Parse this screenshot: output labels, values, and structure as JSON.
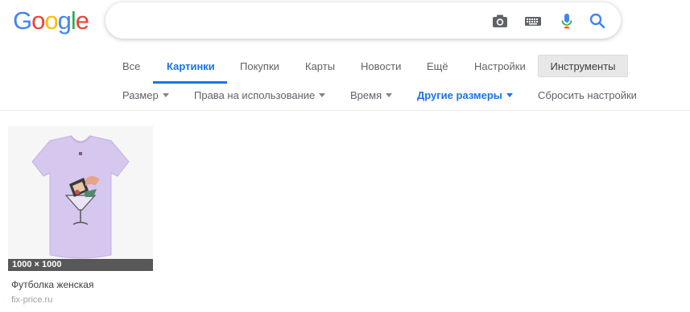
{
  "logo": {
    "letters": [
      "G",
      "o",
      "o",
      "g",
      "l",
      "e"
    ],
    "colors": [
      "#4285f4",
      "#ea4335",
      "#fbbc05",
      "#4285f4",
      "#34a853",
      "#ea4335"
    ]
  },
  "search": {
    "value": "",
    "placeholder": ""
  },
  "tabs": [
    {
      "label": "Все"
    },
    {
      "label": "Картинки",
      "active": true
    },
    {
      "label": "Покупки"
    },
    {
      "label": "Карты"
    },
    {
      "label": "Новости"
    },
    {
      "label": "Ещё"
    },
    {
      "label": "Настройки"
    }
  ],
  "tools_label": "Инструменты",
  "filters": [
    {
      "label": "Размер"
    },
    {
      "label": "Права на использование"
    },
    {
      "label": "Время"
    },
    {
      "label": "Другие размеры",
      "highlighted": true
    },
    {
      "label": "Сбросить настройки"
    }
  ],
  "results": [
    {
      "dimensions": "1000 × 1000",
      "title": "Футболка женская",
      "source": "fix-price.ru"
    }
  ],
  "colors": {
    "accent": "#1a73e8",
    "shirt": "#d6c7ee"
  }
}
